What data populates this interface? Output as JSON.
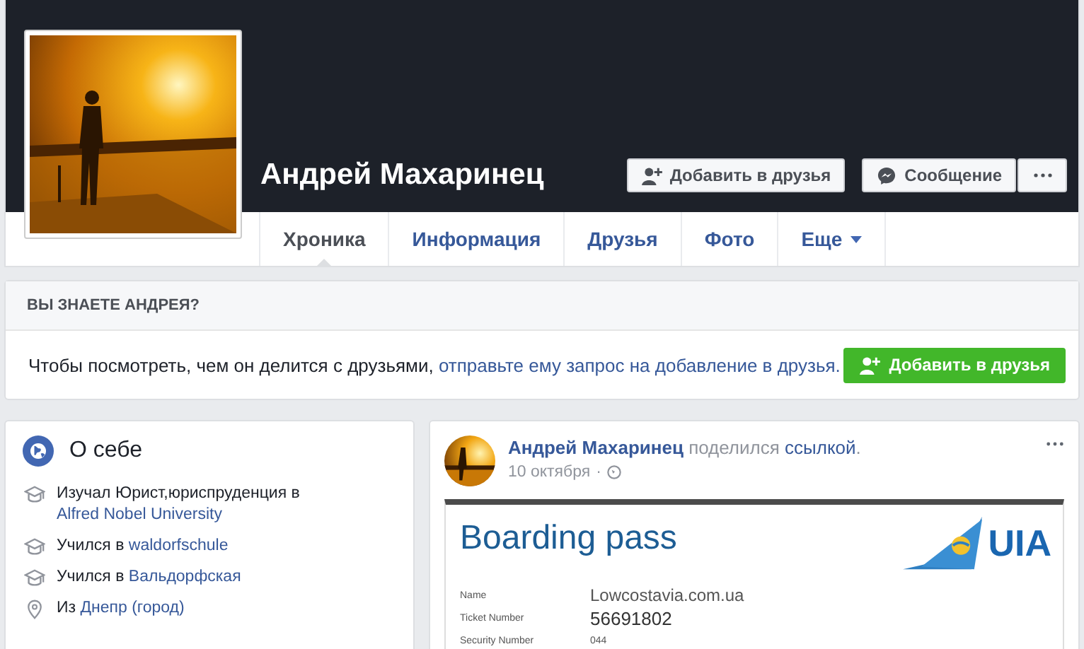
{
  "profile": {
    "name": "Андрей Махаринец"
  },
  "actions": {
    "add_friend": "Добавить в друзья",
    "message": "Сообщение"
  },
  "tabs": [
    {
      "label": "Хроника",
      "selected": true,
      "has_menu": false
    },
    {
      "label": "Информация",
      "selected": false,
      "has_menu": false
    },
    {
      "label": "Друзья",
      "selected": false,
      "has_menu": false
    },
    {
      "label": "Фото",
      "selected": false,
      "has_menu": false
    },
    {
      "label": "Еще",
      "selected": false,
      "has_menu": true
    }
  ],
  "know_card": {
    "title": "ВЫ ЗНАЕТЕ АНДРЕЯ?",
    "text": "Чтобы посмотреть, чем он делится с друзьями,",
    "link": "отправьте ему запрос на добавление в друзья.",
    "button": "Добавить в друзья"
  },
  "about": {
    "title": "О себе",
    "items": [
      {
        "kind": "education",
        "text": "Изучал Юрист,юриспруденция в",
        "link": "Alfred Nobel University"
      },
      {
        "kind": "education",
        "text": "Учился в",
        "link": "waldorfschule"
      },
      {
        "kind": "education",
        "text": "Учился в",
        "link": "Вальдорфская"
      },
      {
        "kind": "place",
        "text": "Из",
        "link": "Днепр (город)"
      }
    ]
  },
  "post": {
    "author": "Андрей Махаринец",
    "action": "поделился",
    "link": "ссылкой",
    "suffix": ".",
    "date": "10 октября",
    "separator": "·",
    "attachment": {
      "title": "Boarding pass",
      "logo": "UIA",
      "fields": [
        {
          "label": "Name",
          "value": "Lowcostavia.com.ua"
        },
        {
          "label": "Ticket Number",
          "value": "56691802"
        },
        {
          "label": "Security Number",
          "value": "044"
        }
      ]
    }
  }
}
